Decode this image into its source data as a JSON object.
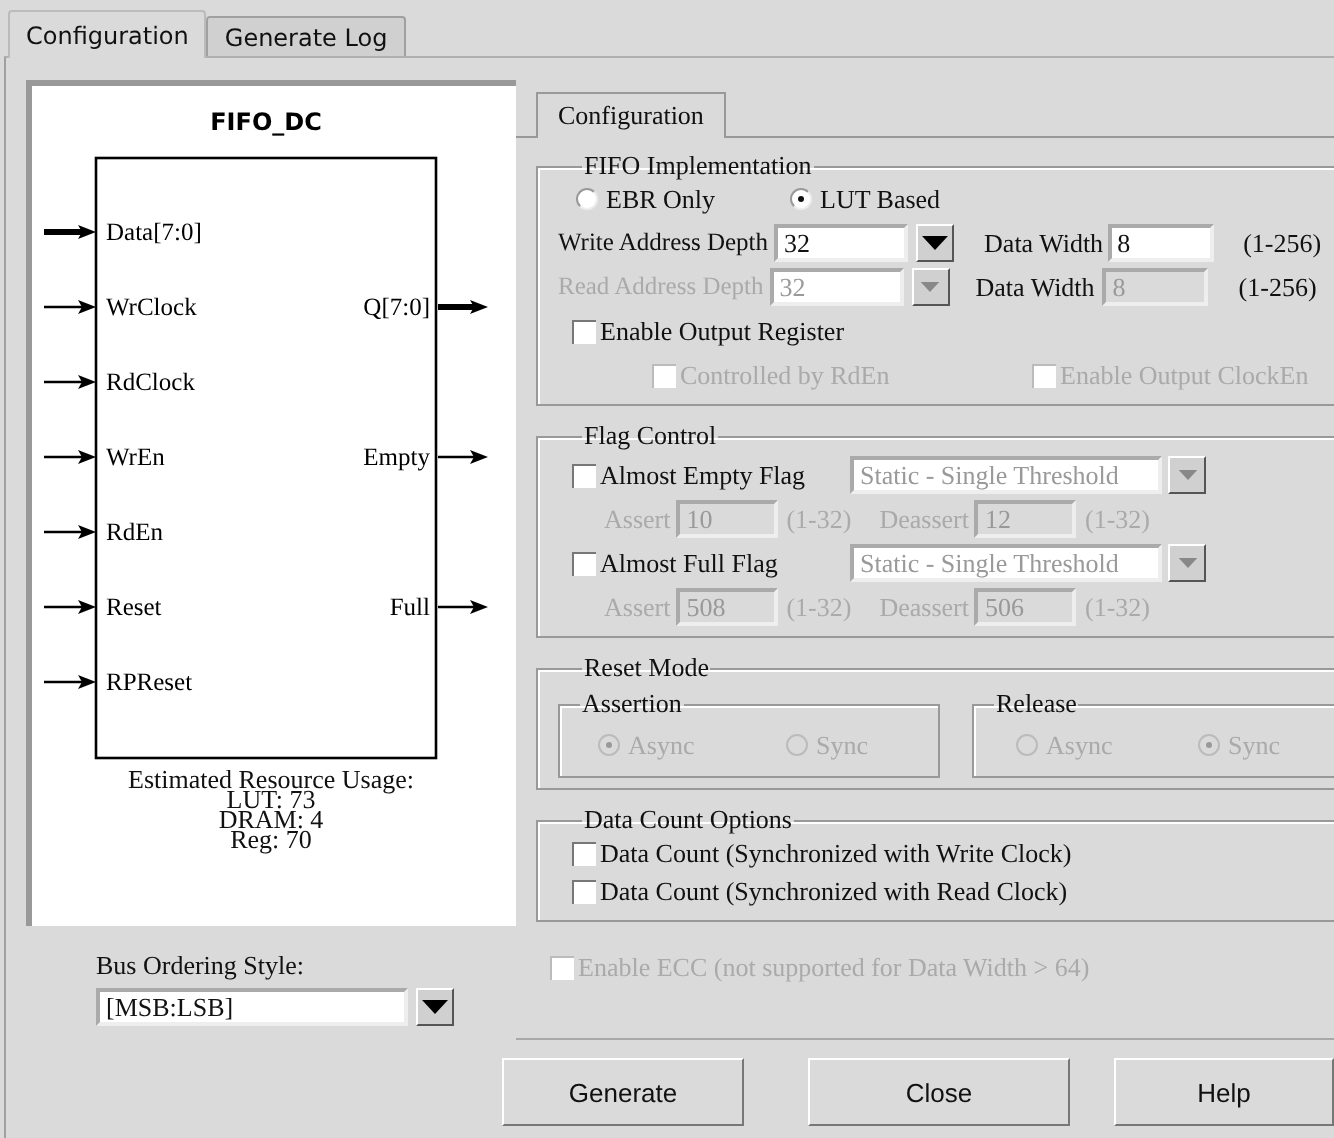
{
  "tabs": [
    {
      "label": "Configuration",
      "selected": true
    },
    {
      "label": "Generate Log",
      "selected": false
    }
  ],
  "diagram": {
    "title": "FIFO_DC",
    "rows": [
      {
        "input": {
          "label": "Data[7:0]",
          "bus": true
        }
      },
      {
        "input": {
          "label": "WrClock",
          "bus": false
        },
        "output": {
          "label": "Q[7:0]",
          "bus": true
        }
      },
      {
        "input": {
          "label": "RdClock",
          "bus": false
        }
      },
      {
        "input": {
          "label": "WrEn",
          "bus": false
        },
        "output": {
          "label": "Empty",
          "bus": false
        }
      },
      {
        "input": {
          "label": "RdEn",
          "bus": false
        }
      },
      {
        "input": {
          "label": "Reset",
          "bus": false
        },
        "output": {
          "label": "Full",
          "bus": false
        }
      },
      {
        "input": {
          "label": "RPReset",
          "bus": false
        }
      }
    ],
    "resource_usage": {
      "title": "Estimated Resource Usage:",
      "lines": [
        "LUT: 73",
        "DRAM: 4",
        "Reg: 70"
      ]
    }
  },
  "bus_ordering": {
    "label": "Bus Ordering Style:",
    "value": "[MSB:LSB]"
  },
  "inner_tabs": [
    {
      "label": "Configuration",
      "selected": true
    }
  ],
  "fifo_implementation": {
    "title": "FIFO Implementation",
    "options": [
      {
        "label": "EBR Only",
        "selected": false
      },
      {
        "label": "LUT Based",
        "selected": true
      }
    ],
    "rows": [
      {
        "depth": {
          "label": "Write Address Depth",
          "value": "32",
          "disabled": false
        },
        "width": {
          "label": "Data Width",
          "value": "8",
          "range": "(1-256)",
          "disabled": false
        }
      },
      {
        "depth": {
          "label": "Read Address Depth",
          "value": "32",
          "disabled": true
        },
        "width": {
          "label": "Data Width",
          "value": "8",
          "range": "(1-256)",
          "disabled": true
        }
      }
    ],
    "output_register": {
      "label": "Enable Output Register",
      "checked": false
    },
    "sub_options": [
      {
        "label": "Controlled by RdEn",
        "checked": false,
        "disabled": true
      },
      {
        "label": "Enable Output ClockEn",
        "checked": false,
        "disabled": true
      }
    ]
  },
  "flag_control": {
    "title": "Flag Control",
    "flags": [
      {
        "label": "Almost Empty Flag",
        "checked": false,
        "mode": "Static - Single Threshold",
        "disabled": true,
        "assert": {
          "label": "Assert",
          "value": "10",
          "range": "(1-32)"
        },
        "deassert": {
          "label": "Deassert",
          "value": "12",
          "range": "(1-32)"
        }
      },
      {
        "label": "Almost Full Flag",
        "checked": false,
        "mode": "Static - Single Threshold",
        "disabled": true,
        "assert": {
          "label": "Assert",
          "value": "508",
          "range": "(1-32)"
        },
        "deassert": {
          "label": "Deassert",
          "value": "506",
          "range": "(1-32)"
        }
      }
    ]
  },
  "reset_mode": {
    "title": "Reset Mode",
    "groups": [
      {
        "title": "Assertion",
        "disabled": true,
        "options": [
          {
            "label": "Async",
            "selected": true
          },
          {
            "label": "Sync",
            "selected": false
          }
        ]
      },
      {
        "title": "Release",
        "disabled": true,
        "options": [
          {
            "label": "Async",
            "selected": false
          },
          {
            "label": "Sync",
            "selected": true
          }
        ]
      }
    ]
  },
  "data_count": {
    "title": "Data Count Options",
    "options": [
      {
        "label": "Data Count (Synchronized with Write Clock)",
        "checked": false
      },
      {
        "label": "Data Count (Synchronized with Read Clock)",
        "checked": false
      }
    ]
  },
  "ecc": {
    "label": "Enable ECC (not supported for Data Width > 64)",
    "checked": false,
    "disabled": true
  },
  "buttons": [
    "Generate",
    "Close",
    "Help"
  ]
}
